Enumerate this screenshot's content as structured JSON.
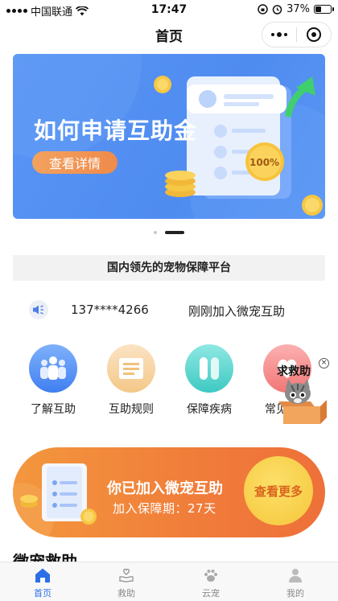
{
  "status_bar": {
    "carrier": "中国联通",
    "time": "17:47",
    "battery": "37%"
  },
  "nav": {
    "title": "首页"
  },
  "banner": {
    "title": "如何申请互助金",
    "button_label": "查看详情",
    "badge": "100%"
  },
  "slogan": "国内领先的宠物保障平台",
  "ticker": {
    "phone": "137****4266",
    "message": "刚刚加入微宠互助"
  },
  "menu": {
    "items": [
      {
        "label": "了解互助",
        "icon": "people-icon"
      },
      {
        "label": "互助规则",
        "icon": "document-icon"
      },
      {
        "label": "保障疾病",
        "icon": "capsule-icon"
      },
      {
        "label": "常见问题",
        "icon": "heart-icon"
      }
    ]
  },
  "helper": {
    "label": "求救助",
    "close": "×"
  },
  "member_card": {
    "title": "你已加入微宠互助",
    "subtitle": "加入保障期：27天",
    "button_label": "查看更多"
  },
  "section_peek": "微宠救助",
  "tabbar": {
    "items": [
      {
        "label": "首页",
        "icon": "home-icon",
        "active": true
      },
      {
        "label": "救助",
        "icon": "hand-heart-icon",
        "active": false
      },
      {
        "label": "云宠",
        "icon": "paw-icon",
        "active": false
      },
      {
        "label": "我的",
        "icon": "user-icon",
        "active": false
      }
    ]
  },
  "colors": {
    "accent_blue": "#4f8cf0",
    "accent_orange": "#f07c3a",
    "tab_active": "#2d6fe6"
  }
}
